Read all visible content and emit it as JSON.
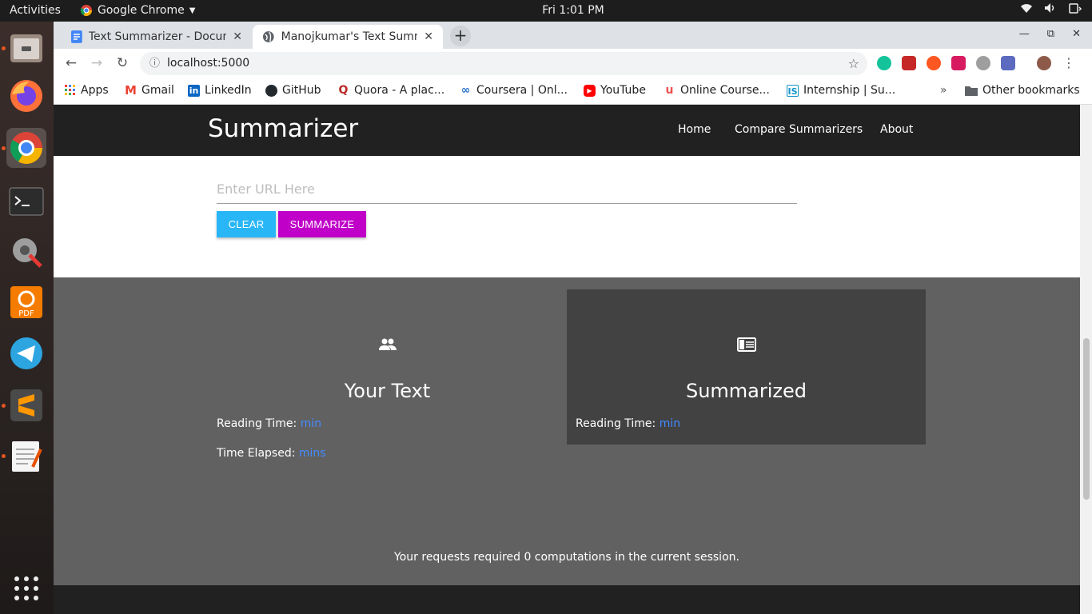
{
  "system": {
    "activities": "Activities",
    "app_name": "Google Chrome",
    "clock": "Fri  1:01 PM"
  },
  "browser": {
    "tabs": [
      {
        "title": "Text Summarizer - Docum",
        "active": false
      },
      {
        "title": "Manojkumar's Text Summ",
        "active": true
      }
    ],
    "url": "localhost:5000",
    "bookmarks": [
      {
        "label": "Apps"
      },
      {
        "label": "Gmail"
      },
      {
        "label": "LinkedIn"
      },
      {
        "label": "GitHub"
      },
      {
        "label": "Quora - A plac..."
      },
      {
        "label": "Coursera | Onl..."
      },
      {
        "label": "YouTube"
      },
      {
        "label": "Online Course..."
      },
      {
        "label": "Internship | Su..."
      }
    ],
    "overflow": "»",
    "other_bookmarks": "Other bookmarks"
  },
  "site": {
    "brand": "Summarizer",
    "nav": [
      {
        "label": "Home"
      },
      {
        "label": "Compare Summarizers"
      },
      {
        "label": "About"
      }
    ],
    "url_placeholder": "Enter URL Here",
    "clear_label": "CLEAR",
    "summarize_label": "SUMMARIZE",
    "your_text": {
      "heading": "Your Text",
      "icon": "people-icon",
      "reading_time_label": "Reading Time:",
      "reading_time_value": "min",
      "elapsed_label": "Time Elapsed:",
      "elapsed_value": "mins"
    },
    "summarized": {
      "heading": "Summarized",
      "icon": "article-icon",
      "reading_time_label": "Reading Time:",
      "reading_time_value": "min"
    },
    "session_note": "Your requests required 0 computations in the current session."
  },
  "colors": {
    "clear_button": "#29b6f6",
    "summarize_button": "#c000c8",
    "navbar": "#212121",
    "results_bg": "#616161",
    "summarized_card": "#424242",
    "value_link": "#448aff"
  }
}
